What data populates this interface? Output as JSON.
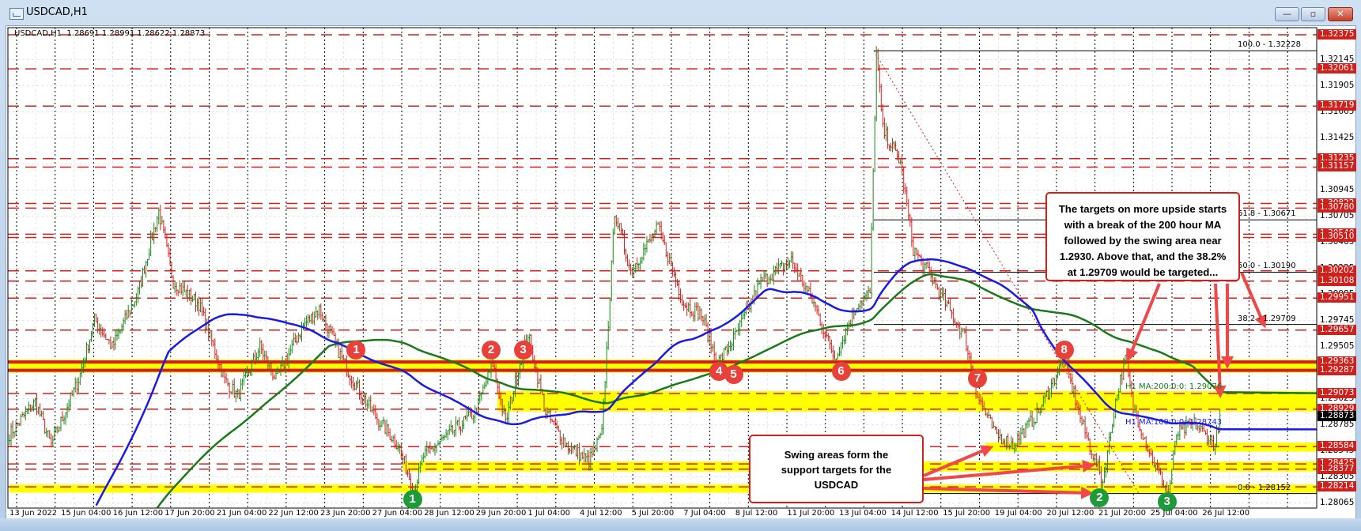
{
  "window": {
    "title": "USDCAD,H1",
    "minimize": "—",
    "maximize": "▫",
    "close": "✕"
  },
  "chart": {
    "info": "USDCAD,H1  1.28691 1.28991 1.28622 1.28873"
  },
  "colors": {
    "up": "#1a8a1a",
    "down": "#d0201c",
    "ma100": "#1a1ae6",
    "ma200": "#1a7a1a",
    "level": "#d0201c",
    "band": "#ffff00",
    "fib": "#000000"
  },
  "chart_data": {
    "type": "candlestick",
    "symbol": "USDCAD",
    "timeframe": "H1",
    "ohlc_last": {
      "open": 1.28691,
      "high": 1.28991,
      "low": 1.28622,
      "close": 1.28873
    },
    "current_price": "1.28873",
    "ylim": [
      1.28,
      1.3245
    ],
    "price_path": [
      [
        0,
        1.287
      ],
      [
        16,
        1.29
      ],
      [
        26,
        1.286
      ],
      [
        43,
        1.292
      ],
      [
        53,
        1.2975
      ],
      [
        64,
        1.295
      ],
      [
        80,
        1.3
      ],
      [
        93,
        1.3075
      ],
      [
        102,
        1.301
      ],
      [
        118,
        1.299
      ],
      [
        134,
        1.292
      ],
      [
        142,
        1.2905
      ],
      [
        156,
        1.295
      ],
      [
        166,
        1.292
      ],
      [
        183,
        1.297
      ],
      [
        193,
        1.2985
      ],
      [
        210,
        1.293
      ],
      [
        226,
        1.289
      ],
      [
        242,
        1.286
      ],
      [
        252,
        1.2818
      ],
      [
        258,
        1.285
      ],
      [
        274,
        1.287
      ],
      [
        290,
        1.289
      ],
      [
        301,
        1.2935
      ],
      [
        309,
        1.288
      ],
      [
        317,
        1.293
      ],
      [
        323,
        1.2962
      ],
      [
        334,
        1.289
      ],
      [
        347,
        1.286
      ],
      [
        361,
        1.2845
      ],
      [
        369,
        1.287
      ],
      [
        377,
        1.3075
      ],
      [
        387,
        1.302
      ],
      [
        404,
        1.306
      ],
      [
        420,
        1.299
      ],
      [
        431,
        1.298
      ],
      [
        441,
        1.2935
      ],
      [
        452,
        1.296
      ],
      [
        468,
        1.301
      ],
      [
        487,
        1.303
      ],
      [
        501,
        1.299
      ],
      [
        514,
        1.294
      ],
      [
        528,
        1.299
      ],
      [
        536,
        1.3
      ],
      [
        540,
        1.322
      ],
      [
        544,
        1.315
      ],
      [
        555,
        1.312
      ],
      [
        563,
        1.304
      ],
      [
        576,
        1.301
      ],
      [
        587,
        1.298
      ],
      [
        595,
        1.296
      ],
      [
        603,
        1.2905
      ],
      [
        614,
        1.287
      ],
      [
        625,
        1.286
      ],
      [
        641,
        1.289
      ],
      [
        657,
        1.294
      ],
      [
        668,
        1.288
      ],
      [
        681,
        1.2826
      ],
      [
        689,
        1.29
      ],
      [
        695,
        1.294
      ],
      [
        700,
        1.2895
      ],
      [
        711,
        1.285
      ],
      [
        722,
        1.2815
      ],
      [
        727,
        1.287
      ],
      [
        738,
        1.288
      ],
      [
        751,
        1.286
      ],
      [
        754,
        1.28873
      ]
    ],
    "price_axis_ticks": [
      "1.32145",
      "1.31905",
      "1.31665",
      "1.31425",
      "1.31185",
      "1.30945",
      "1.30705",
      "1.30465",
      "1.30225",
      "1.29985",
      "1.29745",
      "1.29505",
      "1.29265",
      "1.29025",
      "1.28785",
      "1.28545",
      "1.28305",
      "1.28065"
    ],
    "time_axis_labels": [
      "13 Jun 2022",
      "15 Jun 04:00",
      "16 Jun 12:00",
      "17 Jun 20:00",
      "21 Jun 04:00",
      "22 Jun 12:00",
      "23 Jun 20:00",
      "27 Jun 04:00",
      "28 Jun 12:00",
      "29 Jun 20:00",
      "1 Jul 04:00",
      "4 Jul 12:00",
      "5 Jul 20:00",
      "7 Jul 04:00",
      "8 Jul 12:00",
      "11 Jul 20:00",
      "13 Jul 04:00",
      "14 Jul 12:00",
      "15 Jul 20:00",
      "19 Jul 04:00",
      "20 Jul 12:00",
      "21 Jul 20:00",
      "25 Jul 04:00",
      "26 Jul 12:00"
    ],
    "levels": [
      "1.32375",
      "1.32061",
      "1.31719",
      "1.31235",
      "1.31157",
      "1.30822",
      "1.30780",
      "1.30540",
      "1.30510",
      "1.30202",
      "1.30108",
      "1.29951",
      "1.29657",
      "1.29363",
      "1.29287",
      "1.29073",
      "1.28929",
      "1.28584",
      "1.28425",
      "1.28377",
      "1.28214"
    ],
    "strong_levels": [
      "1.29363",
      "1.29287"
    ],
    "bands": [
      [
        1.29287,
        1.29363,
        0
      ],
      [
        1.28929,
        1.29073,
        304
      ],
      [
        1.2856,
        1.286,
        608
      ],
      [
        1.28377,
        1.28425,
        245
      ],
      [
        1.28183,
        1.28214,
        0
      ]
    ],
    "fibonacci": [
      {
        "label": "100.0 - 1.32228",
        "price": 1.32228
      },
      {
        "label": "61.8 - 1.30671",
        "price": 1.30671
      },
      {
        "label": "50.0 - 1.30190",
        "price": 1.3019
      },
      {
        "label": "38.2 - 1.29709",
        "price": 1.29709
      },
      {
        "label": "0.0 - 1.28152",
        "price": 1.28152
      }
    ],
    "moving_averages": [
      {
        "label": "H1 MA:200:0:0: 1.29076",
        "period": 200,
        "value": 1.29076,
        "color": "#1a7a1a"
      },
      {
        "label": "H1 MA:100:0:0: 1.28743",
        "period": 100,
        "value": 1.28743,
        "color": "#1a1ae6"
      }
    ],
    "resistance_markers": [
      {
        "n": "1",
        "idx": 216,
        "price": 1.2947
      },
      {
        "n": "2",
        "idx": 300,
        "price": 1.2947
      },
      {
        "n": "3",
        "idx": 320,
        "price": 1.2947
      },
      {
        "n": "4",
        "idx": 442,
        "price": 1.2928
      },
      {
        "n": "5",
        "idx": 451,
        "price": 1.2925
      },
      {
        "n": "6",
        "idx": 518,
        "price": 1.2928
      },
      {
        "n": "7",
        "idx": 603,
        "price": 1.2921
      },
      {
        "n": "8",
        "idx": 657,
        "price": 1.2947
      }
    ],
    "support_markers": [
      {
        "n": "1",
        "idx": 251,
        "price": 1.281
      },
      {
        "n": "2",
        "idx": 679,
        "price": 1.2811
      },
      {
        "n": "3",
        "idx": 721,
        "price": 1.2808
      }
    ]
  },
  "annotations": {
    "upside": [
      "The targets on more upside starts",
      "with a break of the 200 hour MA",
      "followed by the swing area near",
      "1.2930. Above that, and the 38.2%",
      "at 1.29709 would be targeted..."
    ],
    "swing": [
      "Swing areas form the",
      "support targets for the",
      "USDCAD"
    ]
  }
}
